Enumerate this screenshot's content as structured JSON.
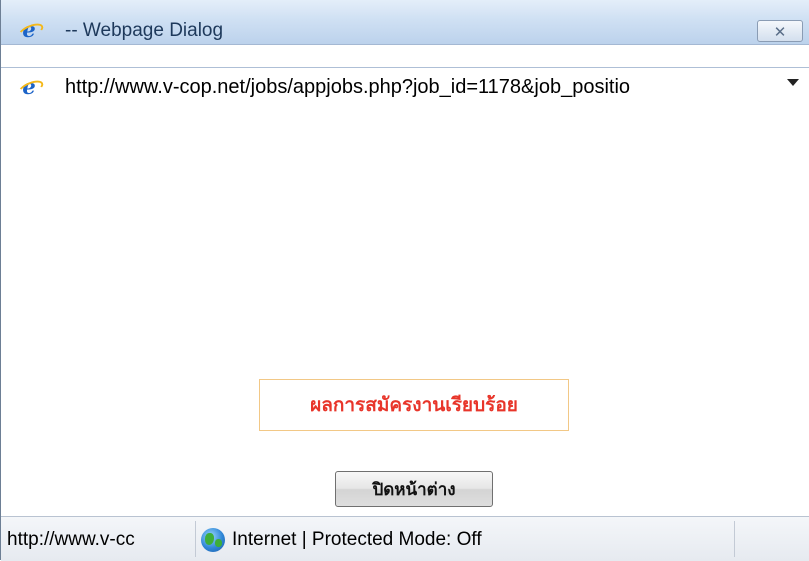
{
  "window": {
    "title": "-- Webpage Dialog",
    "close_icon": "close-icon"
  },
  "address_bar": {
    "url": "http://www.v-cop.net/jobs/appjobs.php?job_id=1178&job_positio",
    "page_icon": "ie-page-icon"
  },
  "content": {
    "result_message": "ผลการสมัครงานเรียบร้อย",
    "close_window_button": "ปิดหน้าต่าง"
  },
  "status_bar": {
    "url": "http://www.v-cc",
    "zone": "Internet | Protected Mode: Off",
    "zone_icon": "globe-icon"
  },
  "colors": {
    "result_text": "#e8352a",
    "result_border": "#f2c886"
  }
}
